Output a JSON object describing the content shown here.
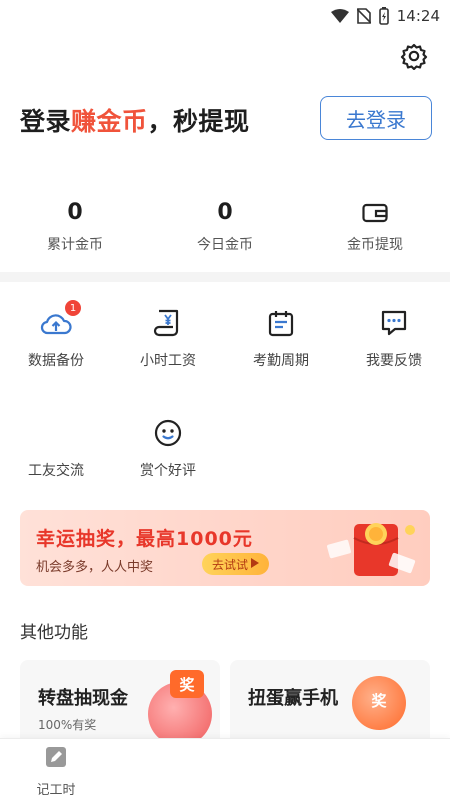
{
  "status_bar": {
    "time": "14:24",
    "icons": [
      "wifi-icon",
      "no-sim-icon",
      "battery-charging-icon"
    ]
  },
  "header": {
    "login_prefix": "登录",
    "login_highlight": "赚金币",
    "login_suffix": "，秒提现",
    "login_button": "去登录",
    "settings_icon": "gear-icon"
  },
  "stats": {
    "total_coins": {
      "value": "0",
      "label": "累计金币"
    },
    "today_coins": {
      "value": "0",
      "label": "今日金币"
    },
    "withdraw": {
      "icon": "wallet-icon",
      "label": "金币提现"
    }
  },
  "tools": [
    {
      "label": "数据备份",
      "icon": "cloud-upload-icon",
      "badge": "1"
    },
    {
      "label": "小时工资",
      "icon": "salary-scroll-icon"
    },
    {
      "label": "考勤周期",
      "icon": "calendar-icon"
    },
    {
      "label": "我要反馈",
      "icon": "feedback-chat-icon"
    },
    {
      "label": "工友交流",
      "icon": "group-icon"
    },
    {
      "label": "赏个好评",
      "icon": "smile-icon"
    }
  ],
  "banner": {
    "title": "幸运抽奖，最高1000元",
    "subtitle": "机会多多，人人中奖",
    "try_button": "去试试"
  },
  "other": {
    "title": "其他功能",
    "cards": [
      {
        "title": "转盘抽现金",
        "subtitle": "100%有奖",
        "tag": "奖"
      },
      {
        "title": "扭蛋赢手机",
        "subtitle": "",
        "tag": "奖"
      }
    ]
  },
  "tabbar": {
    "tabs": [
      {
        "label": "记工时",
        "icon": "pencil-icon"
      }
    ]
  },
  "colors": {
    "accent": "#f0533b",
    "primary_blue": "#3a78cf",
    "badge_red": "#f04438"
  }
}
